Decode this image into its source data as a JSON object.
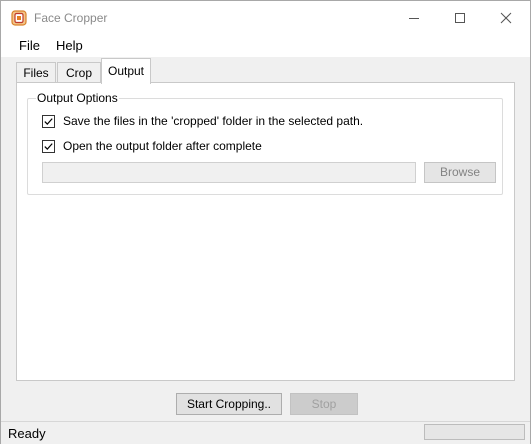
{
  "window": {
    "title": "Face Cropper"
  },
  "menu": {
    "items": [
      "File",
      "Help"
    ]
  },
  "tabs": [
    {
      "label": "Files"
    },
    {
      "label": "Crop"
    },
    {
      "label": "Output",
      "active": true
    }
  ],
  "output_options": {
    "legend": "Output Options",
    "save_in_cropped": {
      "label": "Save the files in the 'cropped' folder in the selected path.",
      "checked": true
    },
    "open_after_complete": {
      "label": "Open the output folder after complete",
      "checked": true
    },
    "path": {
      "value": ""
    },
    "browse_label": "Browse"
  },
  "actions": {
    "start_label": "Start Cropping..",
    "stop_label": "Stop"
  },
  "status": {
    "text": "Ready",
    "progress": 0
  },
  "colors": {
    "accent": "#0078d7",
    "app_icon": "#e67e22",
    "progress_fill": "#06b025"
  },
  "icons": {
    "app": "face-cropper-app-icon",
    "minimize": "minimize-icon",
    "maximize": "maximize-icon",
    "close": "close-icon",
    "check": "checkmark-icon"
  }
}
